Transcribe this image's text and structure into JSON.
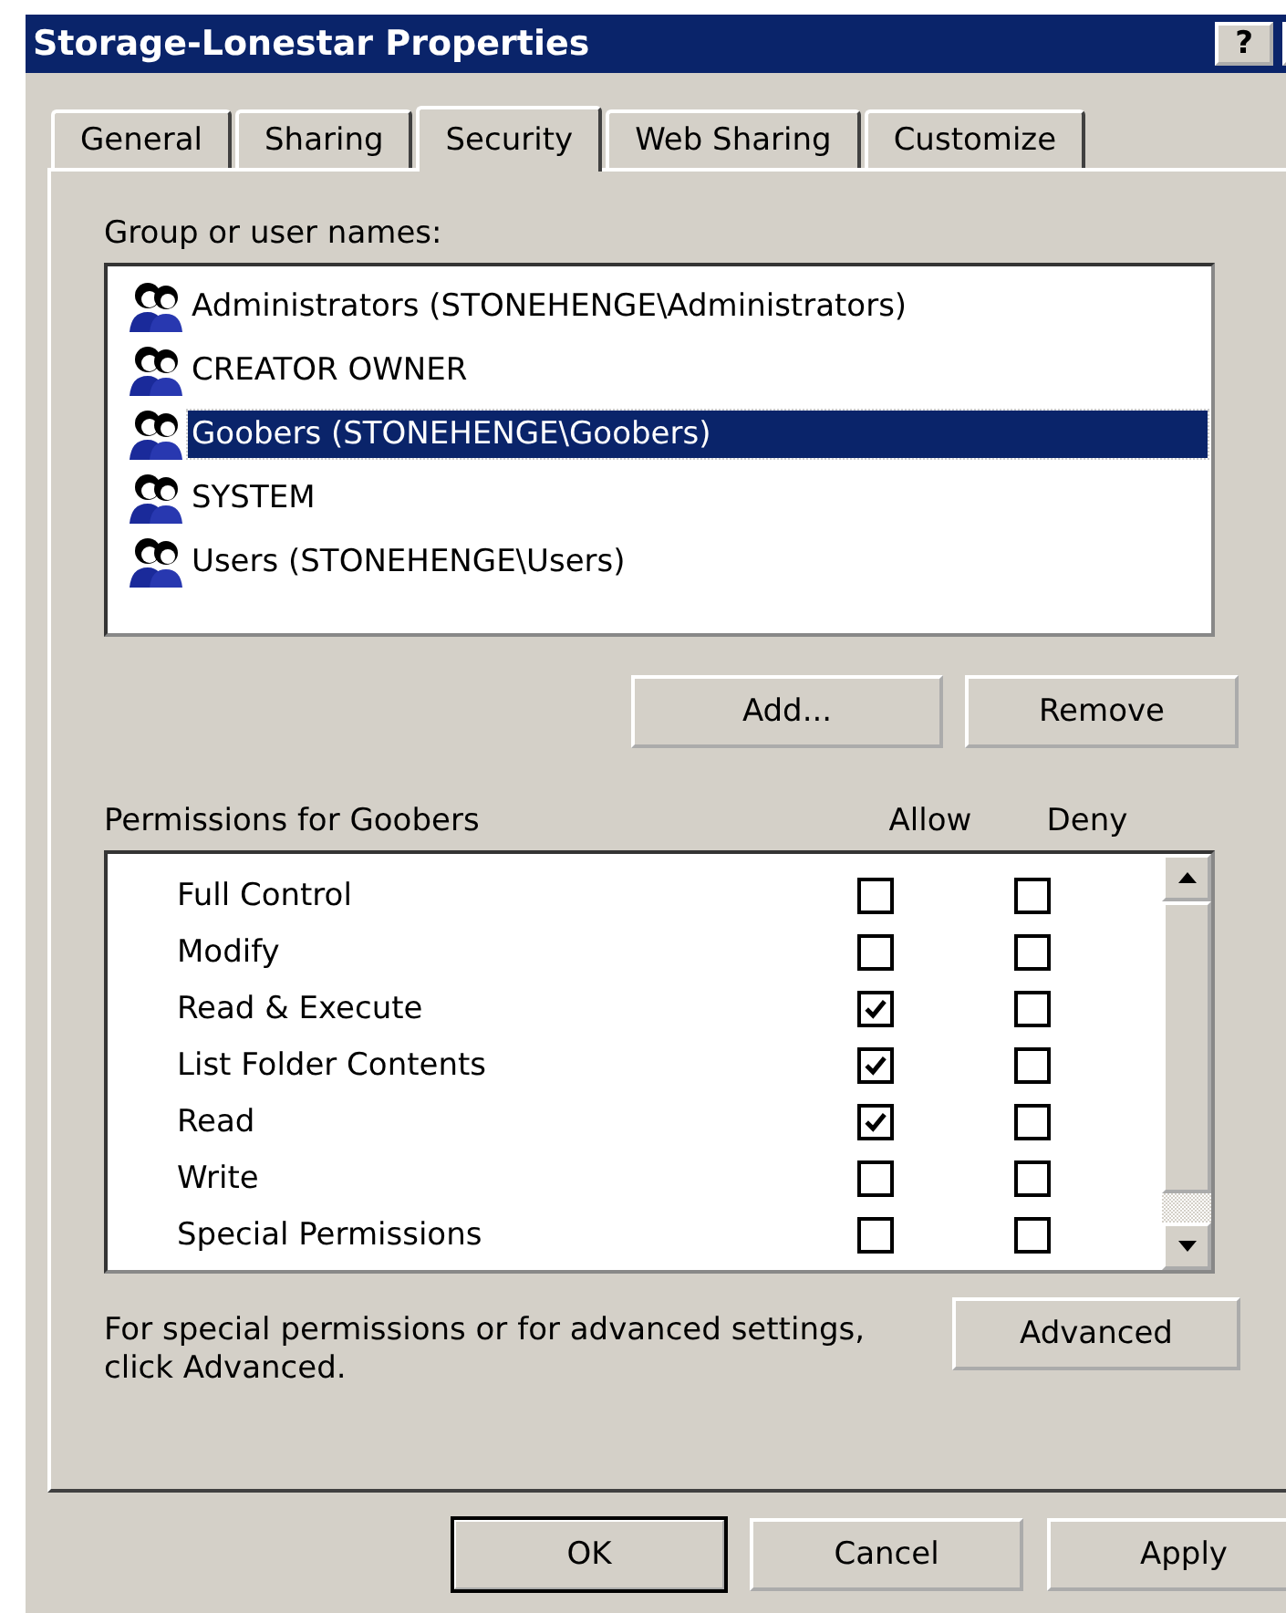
{
  "window": {
    "title": "Storage-Lonestar Properties",
    "help_button": "?"
  },
  "tabs": [
    {
      "label": "General",
      "selected": false
    },
    {
      "label": "Sharing",
      "selected": false
    },
    {
      "label": "Security",
      "selected": true
    },
    {
      "label": "Web Sharing",
      "selected": false
    },
    {
      "label": "Customize",
      "selected": false
    }
  ],
  "group_list": {
    "label": "Group or user names:",
    "items": [
      {
        "name": "Administrators (STONEHENGE\\Administrators)",
        "selected": false
      },
      {
        "name": "CREATOR OWNER",
        "selected": false
      },
      {
        "name": "Goobers (STONEHENGE\\Goobers)",
        "selected": true
      },
      {
        "name": "SYSTEM",
        "selected": false
      },
      {
        "name": "Users (STONEHENGE\\Users)",
        "selected": false
      }
    ]
  },
  "group_buttons": [
    "Add...",
    "Remove"
  ],
  "permissions": {
    "label": "Permissions for Goobers",
    "columns": [
      "Allow",
      "Deny"
    ],
    "rows": [
      {
        "name": "Full Control",
        "allow": false,
        "deny": false
      },
      {
        "name": "Modify",
        "allow": false,
        "deny": false
      },
      {
        "name": "Read & Execute",
        "allow": true,
        "deny": false
      },
      {
        "name": "List Folder Contents",
        "allow": true,
        "deny": false
      },
      {
        "name": "Read",
        "allow": true,
        "deny": false
      },
      {
        "name": "Write",
        "allow": false,
        "deny": false
      },
      {
        "name": "Special Permissions",
        "allow": false,
        "deny": false
      }
    ]
  },
  "advanced": {
    "note": "For special permissions or for advanced settings, click Advanced.",
    "button": "Advanced"
  },
  "buttons": [
    {
      "label": "OK",
      "default": true
    },
    {
      "label": "Cancel",
      "default": false
    },
    {
      "label": "Apply",
      "default": false
    }
  ]
}
